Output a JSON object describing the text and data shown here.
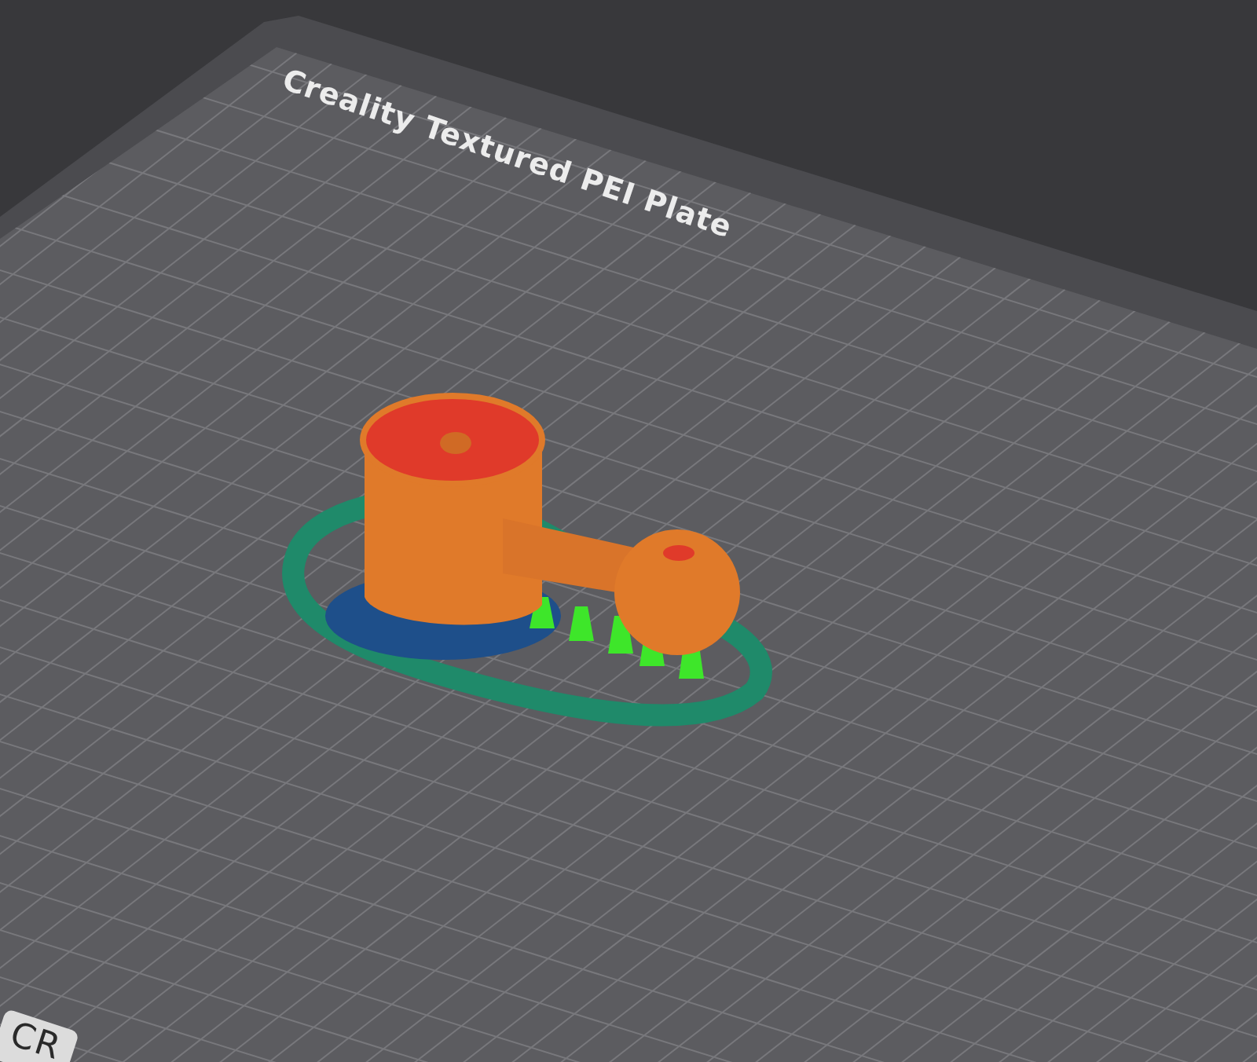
{
  "viewport": {
    "plate_label": "Creality Textured PEI Plate",
    "logo_text": "CR"
  }
}
